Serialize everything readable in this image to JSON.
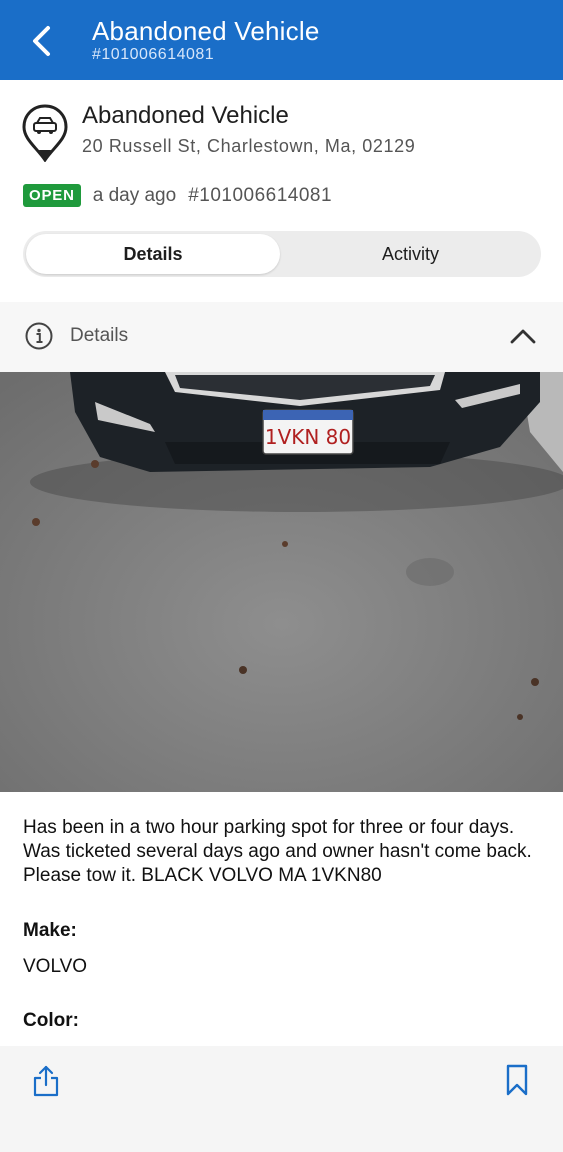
{
  "appbar": {
    "title": "Abandoned Vehicle",
    "subtitle": "#101006614081",
    "back_icon": "chevron-left-icon"
  },
  "request": {
    "title": "Abandoned Vehicle",
    "address": "20 Russell St, Charlestown, Ma, 02129",
    "status": "OPEN",
    "time": "a day ago",
    "case_number": "#101006614081",
    "icon": "map-pin-car-icon"
  },
  "tabs": [
    {
      "label": "Details",
      "selected": true
    },
    {
      "label": "Activity",
      "selected": false
    }
  ],
  "details_section": {
    "title": "Details",
    "expanded": true
  },
  "photo": {
    "plate": "1VKN 80",
    "plate_state": "Massachusetts"
  },
  "description": "Has been in a two hour parking spot for three or four days. Was ticketed several days ago and owner hasn't come back. Please tow it. BLACK VOLVO MA 1VKN80",
  "fields": [
    {
      "label": "Make:",
      "value": "VOLVO"
    },
    {
      "label": "Color:",
      "value": ""
    }
  ],
  "bottom_bar": {
    "share_icon": "share-icon",
    "bookmark_icon": "bookmark-icon"
  },
  "colors": {
    "appbar": "#1a6ec8",
    "status_open": "#1f9a3c",
    "accent_icons": "#1a6ec8"
  }
}
